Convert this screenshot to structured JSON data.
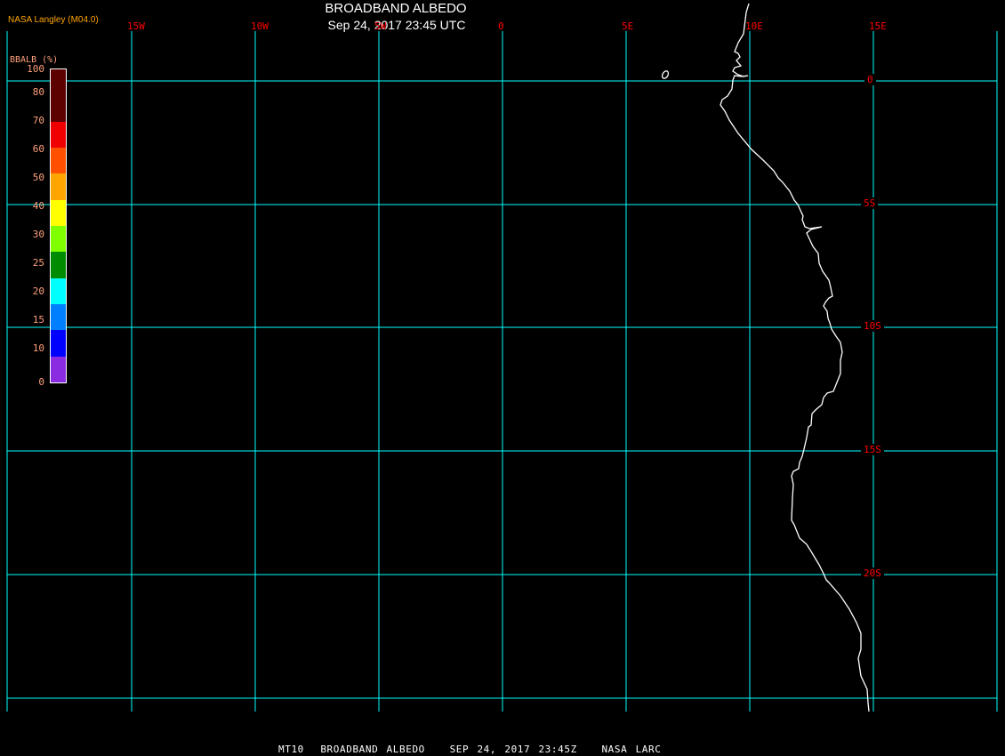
{
  "header": {
    "title": "BROADBAND ALBEDO",
    "subtitle": "Sep 24, 2017 23:45 UTC",
    "credit": "NASA Langley (M04.0)"
  },
  "footer": {
    "text": "MT10  BROADBAND ALBEDO   SEP 24, 2017 23:45Z   NASA LARC"
  },
  "map": {
    "grid_color": "#00ffff",
    "coast_color": "#ffffff",
    "label_color": "#ff0000",
    "lon_labels": [
      "15W",
      "10W",
      "5W",
      "0",
      "5E",
      "10E",
      "15E"
    ],
    "lat_labels": [
      "0",
      "5S",
      "10S",
      "15S",
      "20S"
    ]
  },
  "legend": {
    "title": "BBALB (%)",
    "ticks": [
      "100",
      "80",
      "70",
      "60",
      "50",
      "40",
      "30",
      "25",
      "20",
      "15",
      "10",
      "0"
    ],
    "colors": [
      "#5c0000",
      "#5c0000",
      "#f00000",
      "#ff5000",
      "#ffa500",
      "#ffff00",
      "#80ff00",
      "#008c00",
      "#00ffff",
      "#0080ff",
      "#0000ff",
      "#8a2be2"
    ]
  }
}
